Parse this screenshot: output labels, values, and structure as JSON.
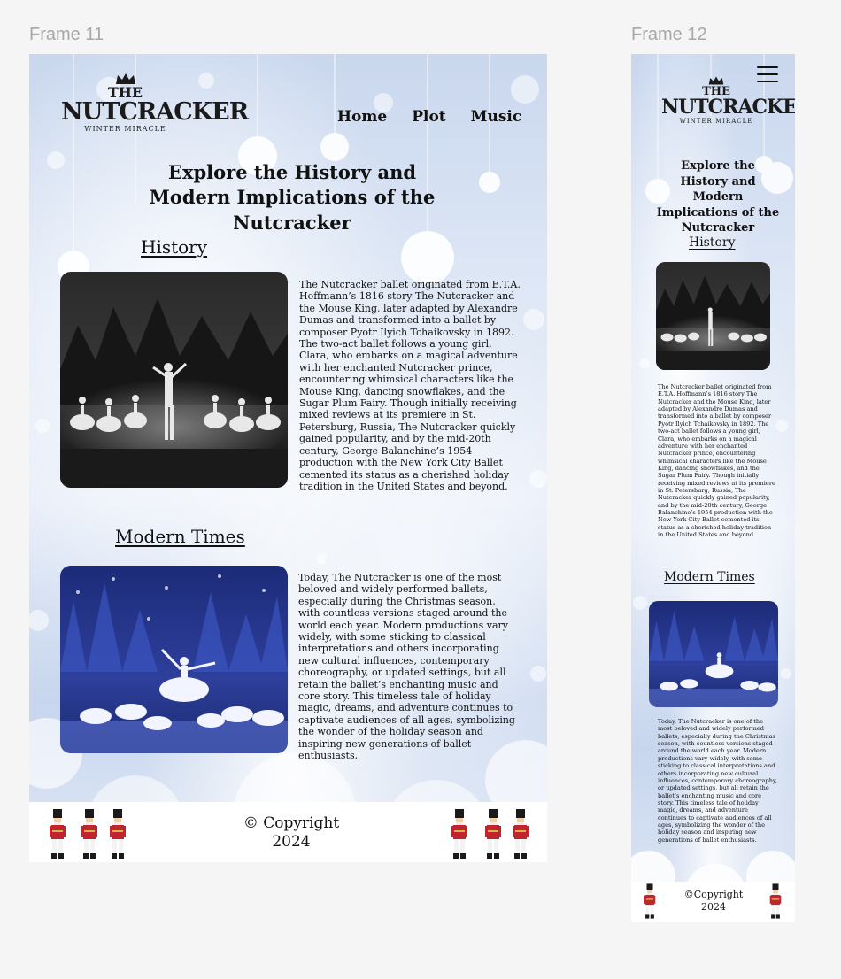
{
  "canvas": {
    "frame11_label": "Frame 11",
    "frame12_label": "Frame 12"
  },
  "site": {
    "logo": {
      "the": "THE",
      "main": "NUTCRACKER",
      "sub": "WINTER MIRACLE"
    },
    "nav": {
      "home": "Home",
      "plot": "Plot",
      "music": "Music"
    },
    "title": "Explore the History and Modern Implications of the Nutcracker",
    "history": {
      "heading": "History",
      "text": "The Nutcracker ballet originated from E.T.A. Hoffmann’s 1816 story The Nutcracker and the Mouse King, later adapted by Alexandre Dumas and transformed into a ballet by composer Pyotr Ilyich Tchaikovsky in 1892. The two-act ballet follows a young girl, Clara, who embarks on a magical adventure with her enchanted Nutcracker prince, encountering whimsical characters like the Mouse King, dancing snowflakes, and the Sugar Plum Fairy. Though initially receiving mixed reviews at its premiere in St. Petersburg, Russia, The Nutcracker quickly gained popularity, and by the mid-20th century, George Balanchine’s 1954 production with the New York City Ballet cemented its status as a cherished holiday tradition in the United States and beyond."
    },
    "modern": {
      "heading": "Modern Times",
      "text": "Today, The Nutcracker is one of the most beloved and widely performed ballets, especially during the Christmas season, with countless versions staged around the world each year. Modern productions vary widely, with some sticking to classical interpretations and others incorporating new cultural influences, contemporary choreography, or updated settings, but all retain the ballet’s enchanting music and core story. This timeless tale of holiday magic, dreams, and adventure continues to captivate audiences of all ages, symbolizing the wonder of the holiday season and inspiring new generations of ballet enthusiasts."
    },
    "footer": {
      "line1": "© Copyright",
      "line2": "2024",
      "mobile_line1": "©Copyright"
    }
  },
  "colors": {
    "text": "#111111",
    "footer_bg": "#ffffff",
    "frame_bg": "#dfe8f6",
    "soldier_red": "#c0242c"
  },
  "icons": [
    "crown-icon",
    "snowflake-icon",
    "nutcracker-soldier-icon",
    "hamburger-menu-icon"
  ]
}
